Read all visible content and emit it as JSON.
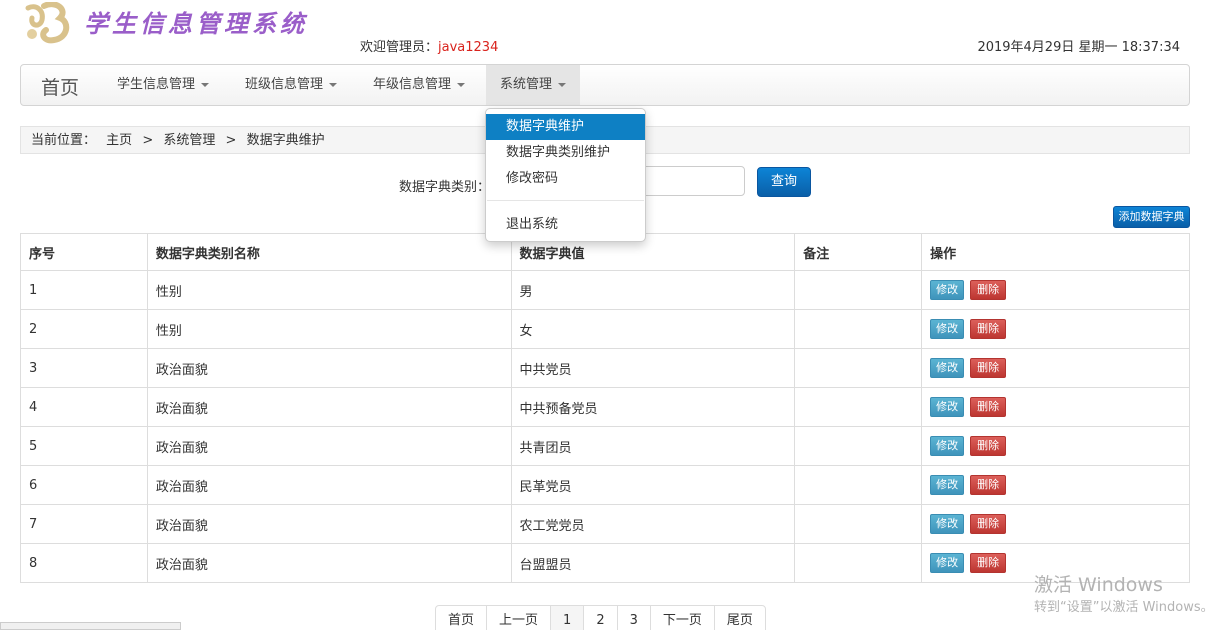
{
  "header": {
    "app_title": "学生信息管理系统",
    "welcome_label": "欢迎管理员：",
    "username": "java1234",
    "datetime": "2019年4月29日 星期一 18:37:34"
  },
  "navbar": {
    "brand": "首页",
    "items": [
      {
        "label": "学生信息管理"
      },
      {
        "label": "班级信息管理"
      },
      {
        "label": "年级信息管理"
      },
      {
        "label": "系统管理"
      }
    ]
  },
  "dropdown": {
    "items": [
      {
        "label": "数据字典维护"
      },
      {
        "label": "数据字典类别维护"
      },
      {
        "label": "修改密码"
      },
      {
        "label": "退出系统"
      }
    ]
  },
  "breadcrumb": {
    "label": "当前位置：",
    "items": [
      "主页",
      "系统管理",
      "数据字典维护"
    ],
    "separator": ">"
  },
  "search": {
    "label": "数据字典类别：",
    "value": "",
    "button": "查询"
  },
  "add_button": "添加数据字典",
  "table": {
    "headers": [
      "序号",
      "数据字典类别名称",
      "数据字典值",
      "备注",
      "操作"
    ],
    "rows": [
      [
        "1",
        "性别",
        "男",
        ""
      ],
      [
        "2",
        "性别",
        "女",
        ""
      ],
      [
        "3",
        "政治面貌",
        "中共党员",
        ""
      ],
      [
        "4",
        "政治面貌",
        "中共预备党员",
        ""
      ],
      [
        "5",
        "政治面貌",
        "共青团员",
        ""
      ],
      [
        "6",
        "政治面貌",
        "民革党员",
        ""
      ],
      [
        "7",
        "政治面貌",
        "农工党党员",
        ""
      ],
      [
        "8",
        "政治面貌",
        "台盟盟员",
        ""
      ]
    ],
    "edit_label": "修改",
    "delete_label": "删除"
  },
  "pagination": [
    "首页",
    "上一页",
    "1",
    "2",
    "3",
    "下一页",
    "尾页"
  ],
  "watermark": {
    "title": "激活 Windows",
    "subtitle": "转到“设置”以激活 Windows。"
  }
}
